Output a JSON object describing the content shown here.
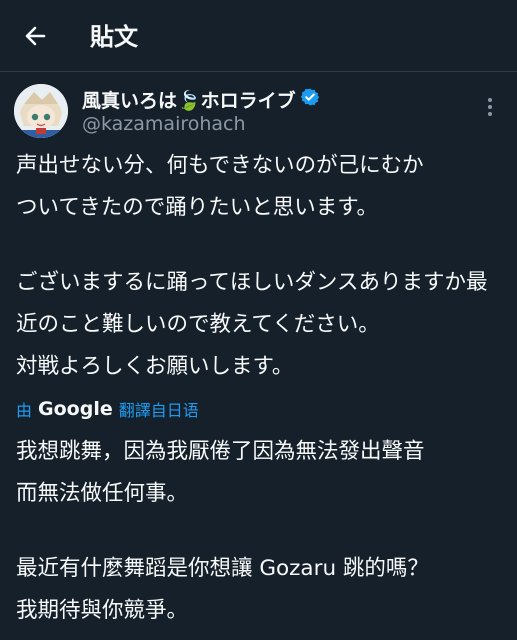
{
  "header": {
    "title": "貼文"
  },
  "author": {
    "name": "風真いろは🍃ホロライブ",
    "handle": "@kazamairohach"
  },
  "post": {
    "lines": [
      "声出せない分、何もできないのが己にむか",
      "ついてきたので踊りたいと思います。",
      "ございまするに踊ってほしいダンスありますか最",
      "近のこと難しいので教えてください。",
      "対戦よろしくお願いします。"
    ]
  },
  "translation": {
    "by_label": "由",
    "provider": "Google",
    "action": "翻譯自日语",
    "lines": [
      "我想跳舞，因為我厭倦了因為無法發出聲音",
      "而無法做任何事。",
      "最近有什麼舞蹈是你想讓 Gozaru 跳的嗎？",
      "我期待與你競爭。"
    ]
  },
  "colors": {
    "background": "#15202b",
    "accent": "#1d9bf0",
    "text": "#f7f9f9",
    "muted": "#8b98a5"
  },
  "icons": {
    "back": "arrow-left-icon",
    "verified": "verified-badge-icon",
    "more": "more-vertical-icon",
    "leaf": "leaf-emoji"
  }
}
